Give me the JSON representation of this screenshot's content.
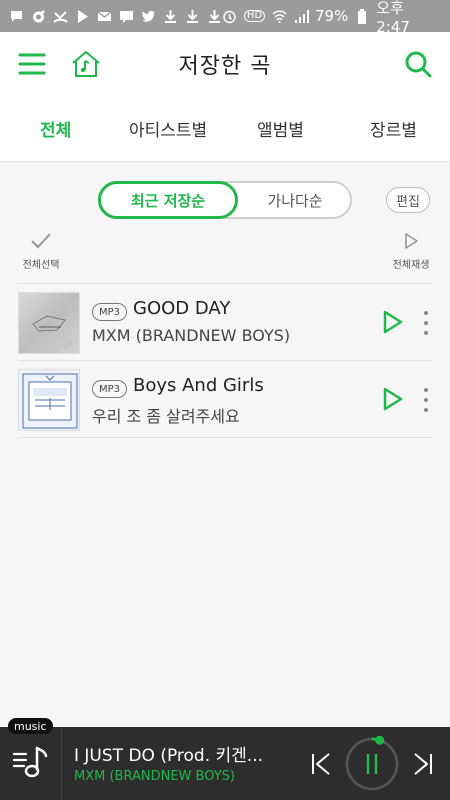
{
  "status_bar": {
    "battery": "79%",
    "time": "오후 2:47",
    "hd": "HD",
    "icons_left": [
      "chat-icon",
      "camera-icon",
      "missed-call-icon",
      "play-store-icon",
      "mail-icon",
      "message-icon",
      "twitter-icon",
      "download-icon",
      "download-icon",
      "download-icon"
    ],
    "icons_right": [
      "alarm-icon",
      "wifi-icon",
      "signal-icon",
      "battery-icon"
    ]
  },
  "header": {
    "title": "저장한 곡"
  },
  "tabs": [
    {
      "label": "전체",
      "active": true
    },
    {
      "label": "아티스트별",
      "active": false
    },
    {
      "label": "앨범별",
      "active": false
    },
    {
      "label": "장르별",
      "active": false
    }
  ],
  "sort": {
    "options": [
      "최근 저장순",
      "가나다순"
    ],
    "selected": "최근 저장순"
  },
  "edit_label": "편집",
  "select_all_label": "전체선택",
  "play_all_label": "전체재생",
  "tracks": [
    {
      "format": "MP3",
      "title": "GOOD DAY",
      "artist": "MXM (BRANDNEW BOYS)"
    },
    {
      "format": "MP3",
      "title": "Boys And Girls",
      "artist": "우리 조 좀 살려주세요"
    }
  ],
  "player": {
    "badge": "music",
    "title": "I JUST DO (Prod. 키겐...",
    "artist": "MXM (BRANDNEW BOYS)",
    "progress": 0.05
  },
  "colors": {
    "accent": "#1fb84a",
    "player_bg": "#2d2d2d",
    "status_bg": "#9b9b9b"
  }
}
